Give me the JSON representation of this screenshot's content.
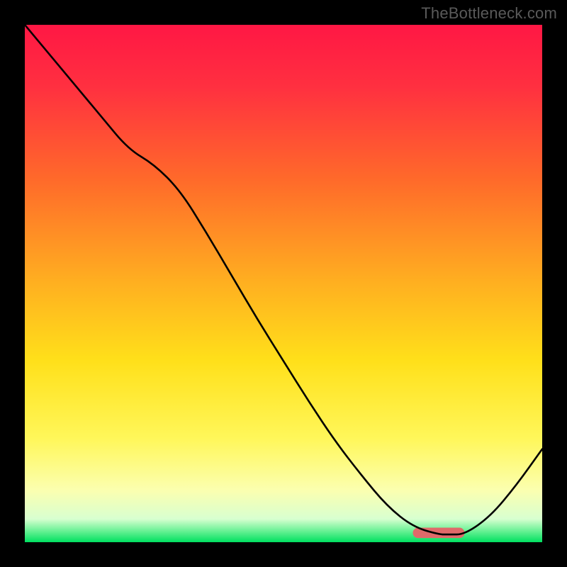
{
  "watermark": "TheBottleneck.com",
  "chart_data": {
    "type": "line",
    "title": "",
    "xlabel": "",
    "ylabel": "",
    "xlim": [
      0,
      100
    ],
    "ylim": [
      0,
      100
    ],
    "grid": false,
    "legend": false,
    "background_gradient": {
      "stops": [
        {
          "offset": 0.0,
          "color": "#ff1744"
        },
        {
          "offset": 0.12,
          "color": "#ff3040"
        },
        {
          "offset": 0.3,
          "color": "#ff6a2a"
        },
        {
          "offset": 0.5,
          "color": "#ffb020"
        },
        {
          "offset": 0.65,
          "color": "#ffe01a"
        },
        {
          "offset": 0.8,
          "color": "#fff75a"
        },
        {
          "offset": 0.9,
          "color": "#fbffb0"
        },
        {
          "offset": 0.955,
          "color": "#d8ffd0"
        },
        {
          "offset": 0.98,
          "color": "#60f090"
        },
        {
          "offset": 1.0,
          "color": "#00e060"
        }
      ]
    },
    "series": [
      {
        "name": "bottleneck-curve",
        "color": "#000000",
        "x": [
          0,
          5,
          10,
          15,
          20,
          25,
          30,
          35,
          40,
          45,
          50,
          55,
          60,
          65,
          70,
          75,
          80,
          82,
          85,
          90,
          95,
          100
        ],
        "y": [
          100,
          94,
          88,
          82,
          76,
          73,
          68,
          60,
          51.5,
          43,
          35,
          27,
          19.5,
          13,
          7,
          3,
          1.5,
          1.5,
          1.5,
          5,
          11,
          18
        ]
      }
    ],
    "flat_marker": {
      "color": "#e06a6a",
      "x_start": 75,
      "x_end": 85,
      "y": 1.8,
      "thickness_pct": 2.0
    }
  }
}
